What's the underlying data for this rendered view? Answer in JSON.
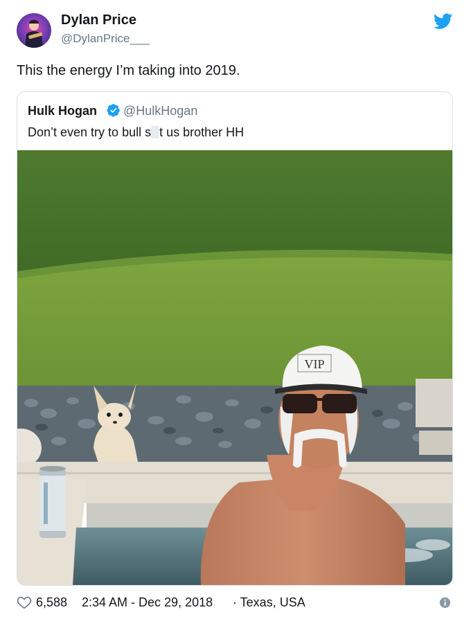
{
  "tweet": {
    "author_name": "Dylan Price",
    "author_handle": "@DylanPrice___",
    "text": "This the energy I’m taking into 2019.",
    "logo_icon": "twitter-bird-icon",
    "brand_color": "#1da1f2"
  },
  "quoted_tweet": {
    "author_name": "Hulk Hogan",
    "verified_icon": "verified-badge-icon",
    "author_handle": "@HulkHogan",
    "text_before": "Don’t even try to bull s",
    "text_after": "t us brother HH",
    "photo_description_icon": "hot-tub-photo",
    "cap_text": "VIP"
  },
  "footer": {
    "like_icon": "heart-icon",
    "likes": "6,588",
    "timestamp": "2:34 AM - Dec 29, 2018",
    "location": "· Texas, USA",
    "info_icon": "info-icon"
  }
}
